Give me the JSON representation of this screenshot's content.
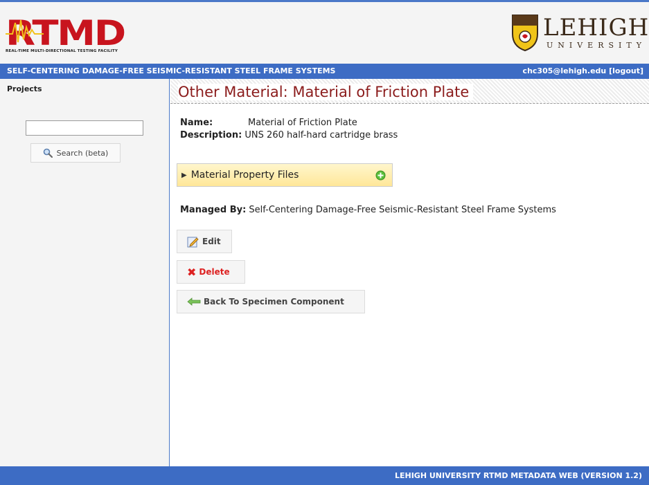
{
  "header": {
    "logo_text": "RTMD",
    "logo_subtitle": "REAL-TIME MULTI-DIRECTIONAL TESTING FACILITY",
    "university_name": "LEHIGH",
    "university_sub": "UNIVERSITY"
  },
  "topbar": {
    "project": "SELF-CENTERING DAMAGE-FREE SEISMIC-RESISTANT STEEL FRAME SYSTEMS",
    "user": "chc305@lehigh.edu [logout]"
  },
  "sidebar": {
    "title": "Projects",
    "search_value": "",
    "search_button": "Search (beta)"
  },
  "main": {
    "title": "Other Material: Material of Friction Plate",
    "name_label": "Name:",
    "name_value": "Material of Friction Plate",
    "description_label": "Description:",
    "description_value": "UNS 260 half-hard cartridge brass",
    "files_panel_label": "Material Property Files",
    "managed_label": "Managed By:",
    "managed_value": "Self-Centering Damage-Free Seismic-Resistant Steel Frame Systems",
    "edit_button": "Edit",
    "delete_button": "Delete",
    "back_button": "Back To Specimen Component"
  },
  "footer": {
    "text": "LEHIGH UNIVERSITY RTMD METADATA WEB (VERSION 1.2)"
  },
  "colors": {
    "accent_blue": "#3d6cc4",
    "title_red": "#8b1c1c",
    "panel_yellow": "#ffe799",
    "delete_red": "#d22222"
  }
}
